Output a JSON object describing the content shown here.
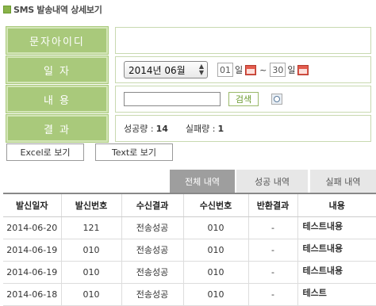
{
  "page": {
    "title": "SMS 발송내역 상세보기"
  },
  "form": {
    "sender_id_label": "문자아이디",
    "date_label": "일 자",
    "date_select_value": "2014년 06월",
    "day_from": "01",
    "day_to": "30",
    "day_unit": "일",
    "tilde": "~",
    "content_label": "내 용",
    "search_label": "검색",
    "result_label": "결 과",
    "success_label": "성공량 :",
    "success_count": "14",
    "fail_label": "실패량 :",
    "fail_count": "1"
  },
  "export": {
    "excel_label": "Excel로 보기",
    "text_label": "Text로 보기"
  },
  "tabs": [
    {
      "label": "전체 내역",
      "active": true
    },
    {
      "label": "성공 내역",
      "active": false
    },
    {
      "label": "실패 내역",
      "active": false
    }
  ],
  "table": {
    "headers": [
      "발신일자",
      "발신번호",
      "수신결과",
      "수신번호",
      "반환결과",
      "내용"
    ],
    "rows": [
      [
        "2014-06-20",
        "121",
        "전송성공",
        "010",
        "-",
        "테스트내용"
      ],
      [
        "2014-06-19",
        "010",
        "전송성공",
        "010",
        "-",
        "테스트내용"
      ],
      [
        "2014-06-19",
        "010",
        "전송성공",
        "010",
        "-",
        "테스트내용"
      ],
      [
        "2014-06-18",
        "010",
        "전송성공",
        "010",
        "-",
        "테스트"
      ]
    ]
  },
  "colors": {
    "label_green": "#a9c97b",
    "tab_active": "#9e9e9e",
    "tab_inactive": "#e7e7e7"
  },
  "icons": {
    "calendar": "calendar-icon",
    "help": "help-icon"
  }
}
